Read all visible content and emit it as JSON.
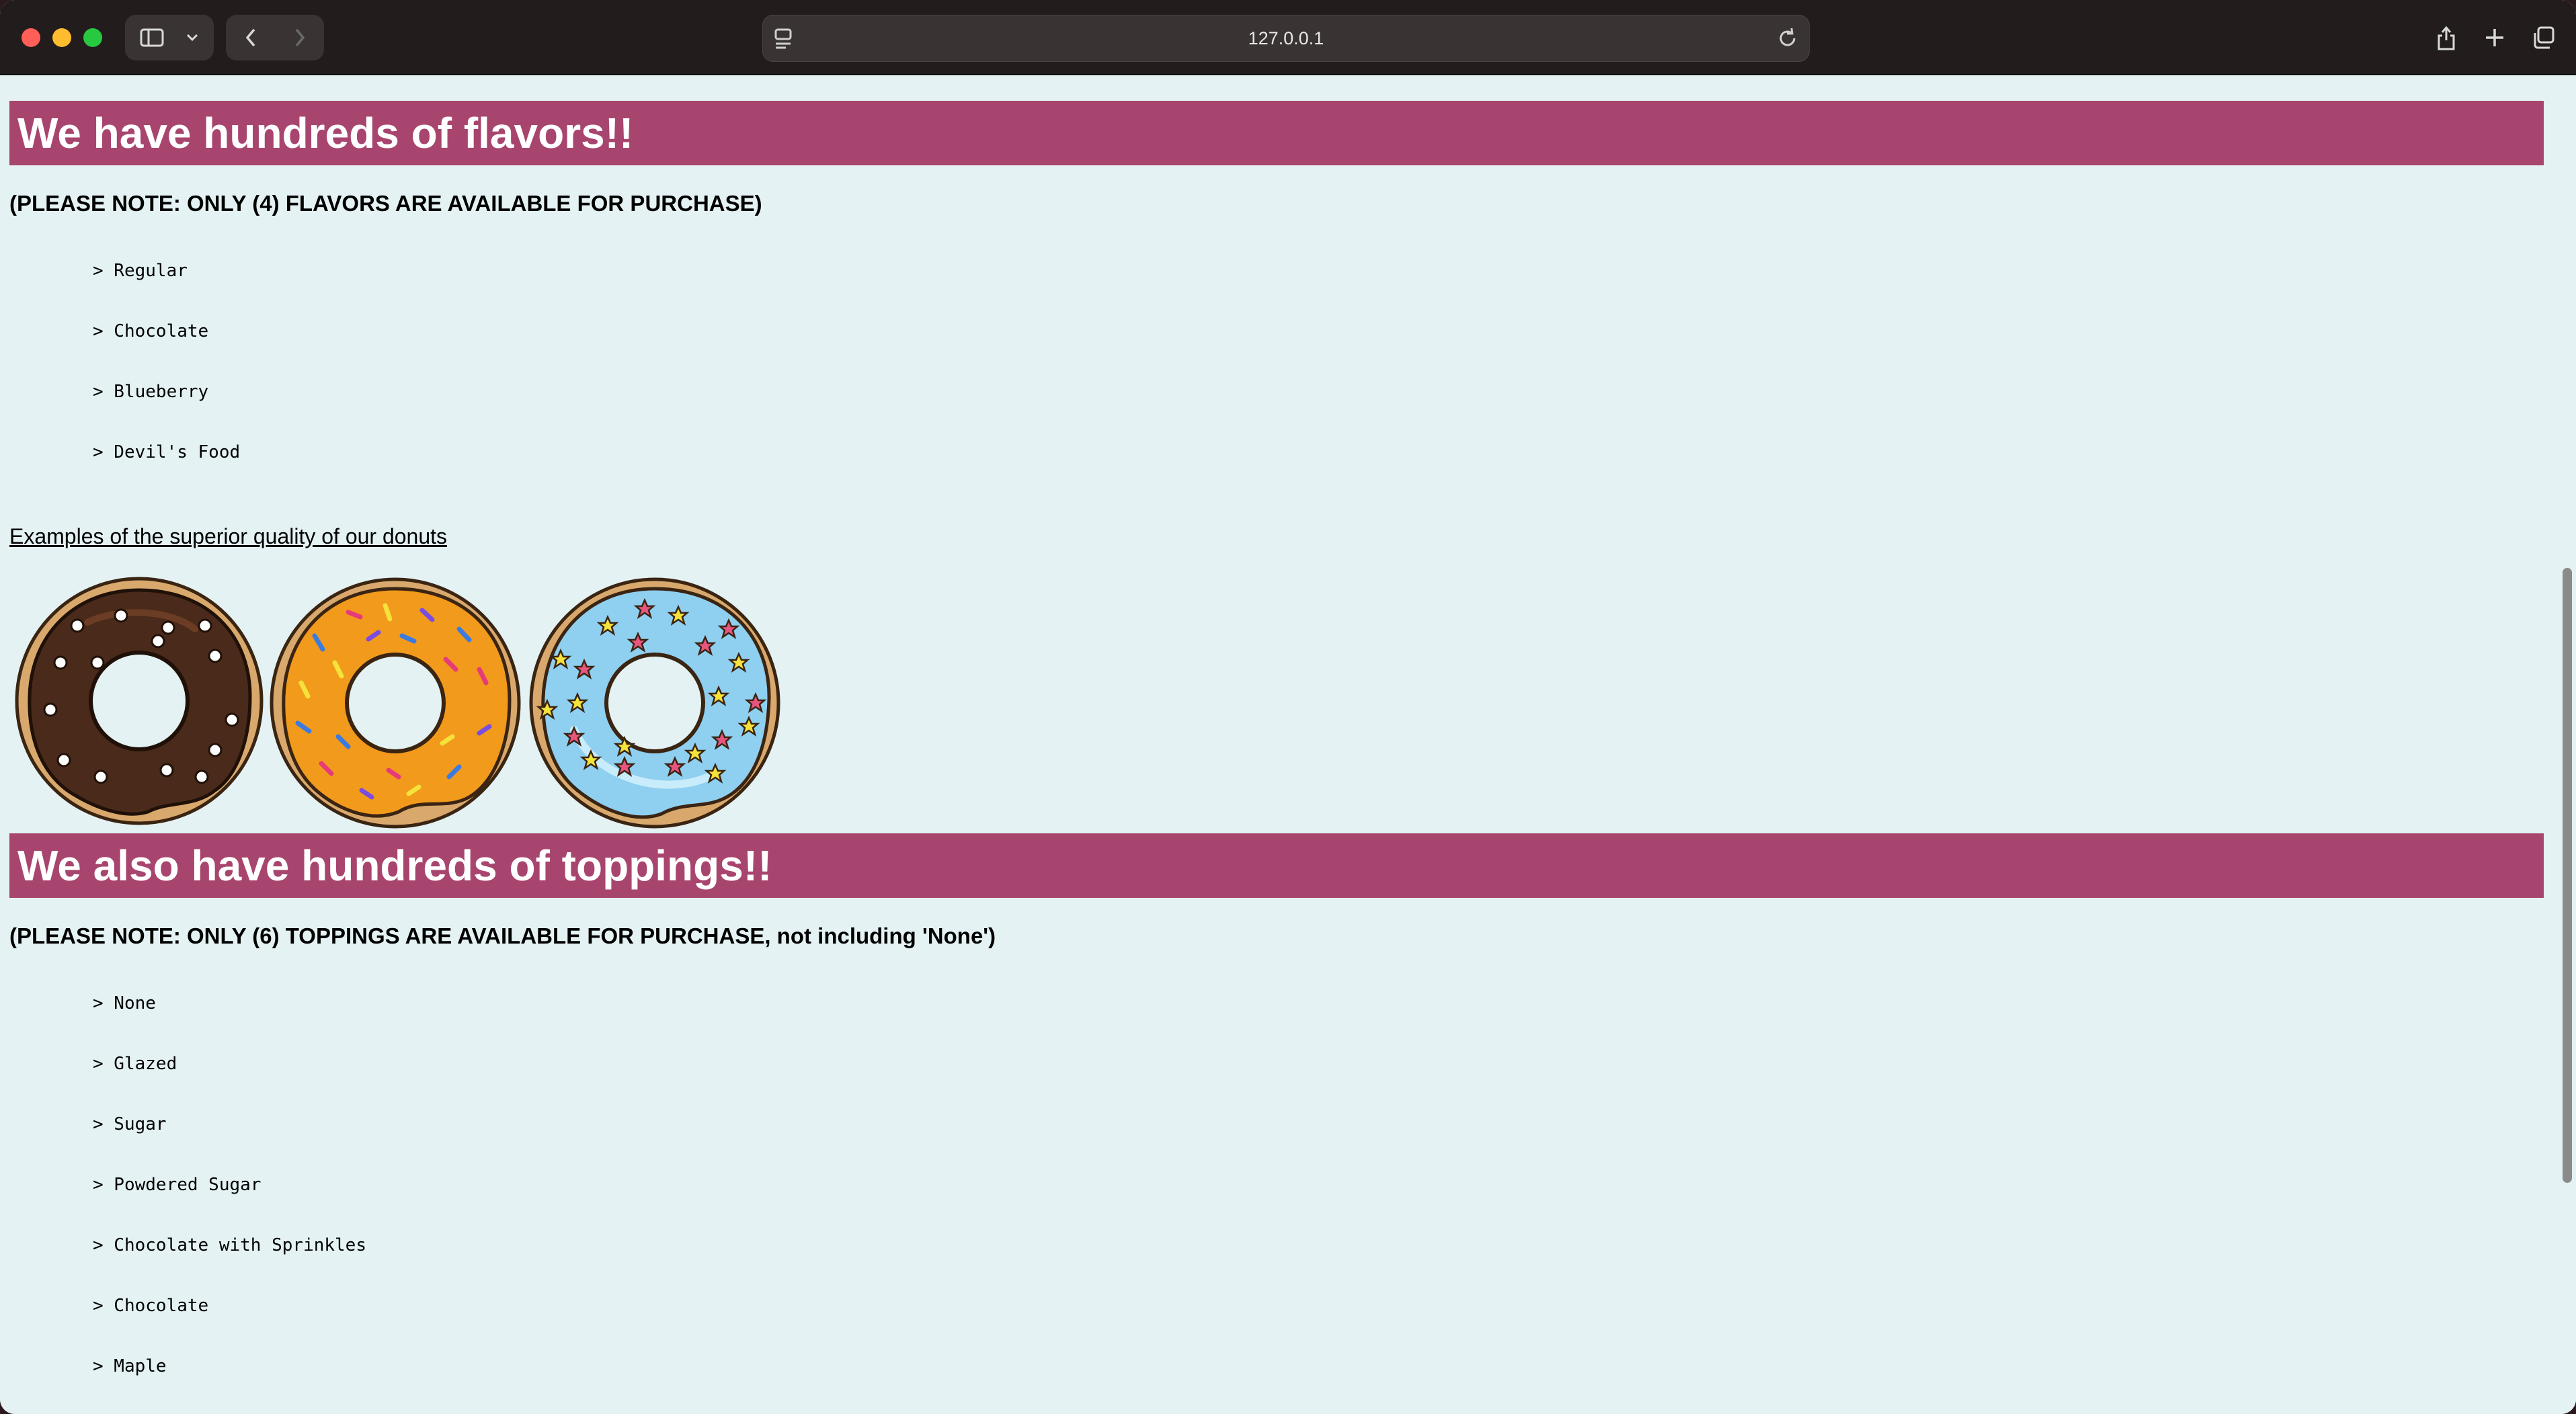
{
  "browser": {
    "url": "127.0.0.1"
  },
  "flavors": {
    "heading": "We have hundreds of flavors!!",
    "note": "(PLEASE NOTE: ONLY (4) FLAVORS ARE AVAILABLE FOR PURCHASE)",
    "items": [
      "> Regular",
      "> Chocolate",
      "> Blueberry",
      "> Devil's Food"
    ]
  },
  "examples_link": "Examples of the superior quality of our donuts",
  "donut_images": [
    "chocolate-sprinkle-donut",
    "orange-rainbow-sprinkle-donut",
    "blue-star-sprinkle-donut"
  ],
  "toppings": {
    "heading": "We also have hundreds of toppings!!",
    "note": "(PLEASE NOTE: ONLY (6) TOPPINGS ARE AVAILABLE FOR PURCHASE, not including 'None')",
    "items": [
      "> None",
      "> Glazed",
      "> Sugar",
      "> Powdered Sugar",
      "> Chocolate with Sprinkles",
      "> Chocolate",
      "> Maple"
    ]
  },
  "colors": {
    "banner": "#a8456e",
    "page_background": "#e4f2f3"
  }
}
